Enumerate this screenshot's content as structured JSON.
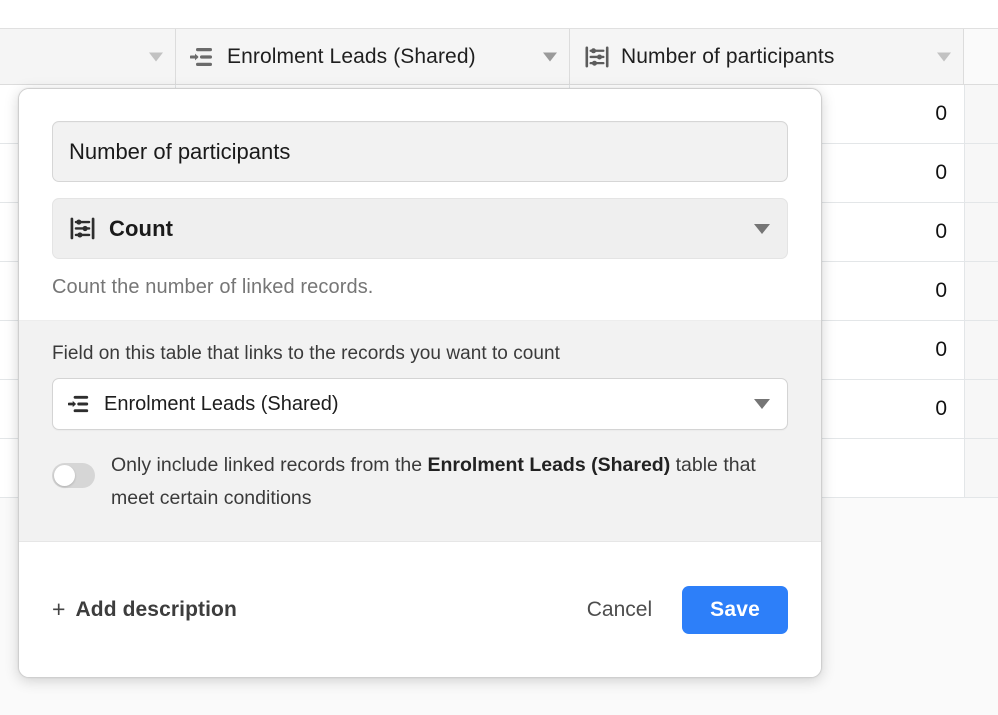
{
  "grid": {
    "columns": [
      {
        "label": "",
        "icon": "",
        "has_chevron": true
      },
      {
        "label": "Enrolment Leads (Shared)",
        "icon": "link-icon",
        "has_chevron": true
      },
      {
        "label": "Number of participants",
        "icon": "count-icon",
        "has_chevron": true
      }
    ],
    "rows": [
      {
        "count": "0"
      },
      {
        "count": "0"
      },
      {
        "count": "0"
      },
      {
        "count": "0"
      },
      {
        "count": "0"
      },
      {
        "count": "0"
      },
      {
        "count": ""
      }
    ]
  },
  "modal": {
    "field_name": {
      "value": "Number of participants",
      "placeholder": "Field name (optional)"
    },
    "field_type": {
      "label": "Count",
      "icon": "count-icon",
      "description": "Count the number of linked records."
    },
    "conditional_panel": {
      "label": "Field on this table that links to the records you want to count",
      "link_field": {
        "label": "Enrolment Leads (Shared)",
        "icon": "link-icon"
      },
      "toggle": {
        "state": "off",
        "text_before": "Only include linked records from the ",
        "text_bold": "Enrolment Leads (Shared)",
        "text_after": " table that meet certain conditions"
      }
    },
    "footer": {
      "add_description_label": "Add description",
      "add_description_plus": "+",
      "cancel_label": "Cancel",
      "save_label": "Save"
    }
  },
  "colors": {
    "accent_blue": "#2d7ff9",
    "panel_gray": "#f2f2f2",
    "header_gray": "#f5f5f5",
    "text_primary": "#1a1a1a",
    "text_muted": "#767676"
  }
}
